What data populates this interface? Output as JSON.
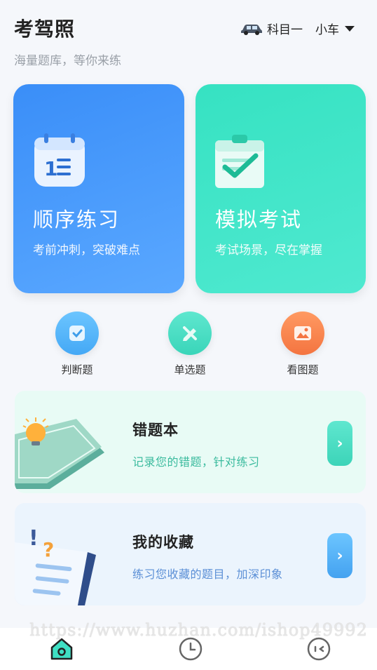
{
  "header": {
    "title": "考驾照",
    "subtitle": "海量题库，等你来练",
    "subject": "科目一",
    "vehicle": "小车"
  },
  "cards": [
    {
      "title": "顺序练习",
      "desc": "考前冲刺，突破难点",
      "icon": "calendar-list-icon",
      "color": "#3a8ef8"
    },
    {
      "title": "模拟考试",
      "desc": "考试场景，尽在掌握",
      "icon": "clipboard-check-icon",
      "color": "#36e2c2"
    }
  ],
  "quick": [
    {
      "label": "判断题",
      "icon": "check-doc-icon"
    },
    {
      "label": "单选题",
      "icon": "pencil-icon"
    },
    {
      "label": "看图题",
      "icon": "image-icon"
    }
  ],
  "rows": [
    {
      "title": "错题本",
      "desc": "记录您的错题，针对练习",
      "icon": "notebook-bulb-icon"
    },
    {
      "title": "我的收藏",
      "desc": "练习您收藏的题目，加深印象",
      "icon": "paper-question-icon"
    }
  ],
  "watermark": "https://www.huzhan.com/ishop49992",
  "tabs": [
    {
      "icon": "home-icon"
    },
    {
      "icon": "history-clock-icon"
    },
    {
      "icon": "more-icon"
    }
  ]
}
